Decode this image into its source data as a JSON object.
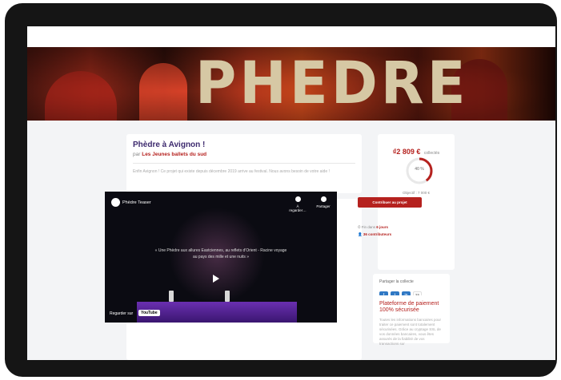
{
  "banner": {
    "title": "PHEDRE"
  },
  "project": {
    "title": "Phèdre à Avignon !",
    "by_prefix": "par",
    "author": "Les Jeunes ballets du sud",
    "description": "Enfin Avignon ! Ce projet qui existe depuis décembre 2019 arrive au festival. Nous avons besoin de votre aide !"
  },
  "video": {
    "title": "Phèdre Teaser",
    "watch_later": "À regarder…",
    "share": "Partager",
    "caption": "« Une Phèdre aux allures Eastciennes, au reflets d'Orient - Racine voyage au pays des mille et une nuits »",
    "watch_on": "Regarder sur",
    "youtube": "YouTube"
  },
  "funding": {
    "amount": "2 809 €",
    "amount_label": "collectés",
    "percent": "40 %",
    "percent_value": 40,
    "goal": "Objectif : 7 000 €",
    "contribute": "Contribuer au projet",
    "days_prefix": "Fin dans",
    "days": "6 jours",
    "contributors": "36 contributeurs"
  },
  "share": {
    "label": "Partager la collecte",
    "buttons": [
      "f",
      "t",
      "in",
      "⛓"
    ]
  },
  "payment": {
    "title": "Plateforme de paiement 100% sécurisée",
    "desc": "Toutes les informations bancaires pour traiter ce paiement sont totalement sécurisées. Grâce au cryptage SSL de vos données bancaires, vous êtes assurés de la fiabilité de vos transactions sur"
  },
  "colors": {
    "accent": "#b5211e",
    "title": "#3d2a6e",
    "share_btn": "#2f78c4"
  }
}
